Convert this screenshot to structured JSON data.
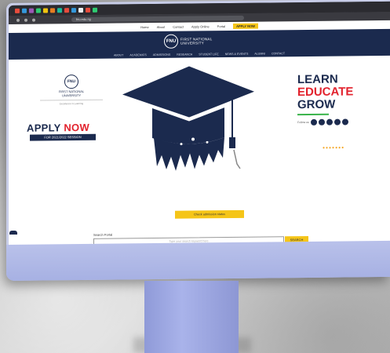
{
  "browser": {
    "url": "fnu.edu.ng"
  },
  "topnav": {
    "items": [
      "Home",
      "About",
      "Contact",
      "Apply Online",
      "Portal"
    ],
    "cta": "APPLY NOW"
  },
  "header": {
    "logo_initials": "FNU",
    "logo_name_1": "FIRST NATIONAL",
    "logo_name_2": "UNIVERSITY",
    "nav": [
      "ABOUT",
      "ACADEMICS",
      "ADMISSIONS",
      "RESEARCH",
      "STUDENT LIFE",
      "NEWS & EVENTS",
      "ALUMNI",
      "CONTACT"
    ]
  },
  "hero": {
    "left_logo_initials": "FNU",
    "left_logo_name_1": "FIRST NATIONAL",
    "left_logo_name_2": "UNIVERSITY",
    "left_logo_sub": "Excellence in Learning",
    "apply_word1": "APPLY",
    "apply_word2": "NOW",
    "apply_badge": "FOR 2021/2022 SESSION",
    "line1": "LEARN",
    "line2": "EDUCATE",
    "line3": "GROW",
    "follow_label": "Follow us",
    "dots": "●●●●●●●"
  },
  "actions": {
    "yellow_button": "Check admission status",
    "search_label": "Search Portal",
    "search_placeholder": "Type your search keyword here",
    "search_button": "SEARCH"
  },
  "colors": {
    "navy": "#1b2a4e",
    "red": "#e2232e",
    "yellow": "#f5c518",
    "green": "#39b34a"
  }
}
